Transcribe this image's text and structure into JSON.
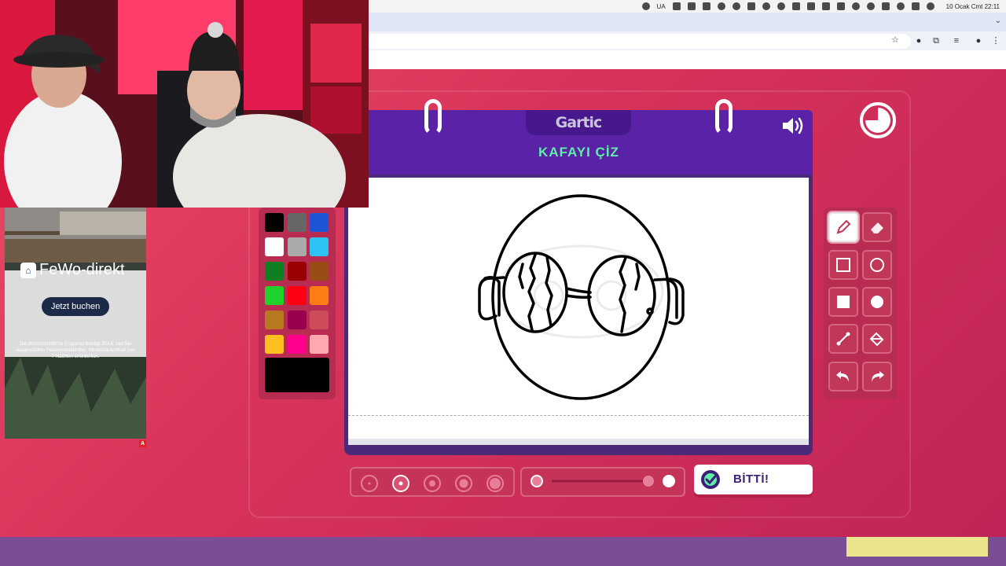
{
  "menubar": {
    "input_source": "UA",
    "clock": "10 Ocak Cmt  22:11"
  },
  "game": {
    "logo": "Gartic",
    "word": "KAFAYI ÇİZ",
    "done_label": "BİTTİ!",
    "palette": [
      "#000000",
      "#666666",
      "#1e55d6",
      "#ffffff",
      "#aaaaaa",
      "#2ec3f5",
      "#0f7f22",
      "#990000",
      "#994c13",
      "#1fd12b",
      "#ff0013",
      "#ff7d14",
      "#b87921",
      "#99004e",
      "#cc4c5c",
      "#ffbf1f",
      "#ff008c",
      "#ffa8b0"
    ],
    "current_color": "#000000",
    "brush_sizes": 5,
    "selected_size_index": 1
  },
  "ad": {
    "brand": "FeWo-direkt",
    "cta": "Jetzt buchen",
    "fine_print": "Die durchschnittliche Ersparnis beträgt 304 €. Nur bei ausgewählten Ferienunterkünften. Mindestaufenthalt von 7 Nächten erforderlich.",
    "badge": "A"
  }
}
